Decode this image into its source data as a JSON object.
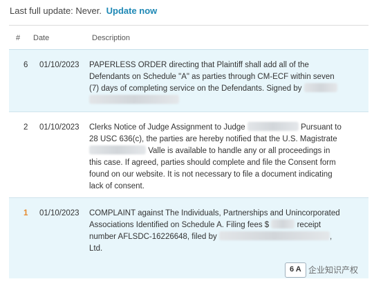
{
  "header": {
    "status_text": "Last full update: Never.",
    "update_link": "Update now"
  },
  "table": {
    "columns": {
      "num": "#",
      "date": "Date",
      "description": "Description"
    },
    "rows": [
      {
        "num": "6",
        "date": "01/10/2023",
        "lines": [
          "PAPERLESS ORDER directing that Plaintiff shall add all of the",
          "Defendants on Schedule \"A\" as parties through CM-ECF within seven",
          "(7) days of completing service on the Defendants. Signed by"
        ]
      },
      {
        "num": "2",
        "date": "01/10/2023",
        "line1_a": "Clerks Notice of Judge Assignment to Judge",
        "line1_b": "Pursuant to",
        "line2": "28 USC 636(c), the parties are hereby notified that the U.S. Magistrate",
        "line3": "Valle is available to handle any or all proceedings in",
        "line4": "this case. If agreed, parties should complete and file the Consent form",
        "line5": "found on our website. It is not necessary to file a document indicating",
        "line6": "lack of consent."
      },
      {
        "num": "1",
        "date": "01/10/2023",
        "line1": "COMPLAINT against The Individuals, Partnerships and Unincorporated",
        "line2_a": "Associations Identified on Schedule A. Filing fees $",
        "line2_b": "receipt",
        "line3_a": "number AFLSDC-16226648, filed by",
        "line3_b": ",",
        "line4": "Ltd."
      }
    ]
  },
  "watermark": {
    "badge": "6 A",
    "text": "企业知识产权"
  }
}
